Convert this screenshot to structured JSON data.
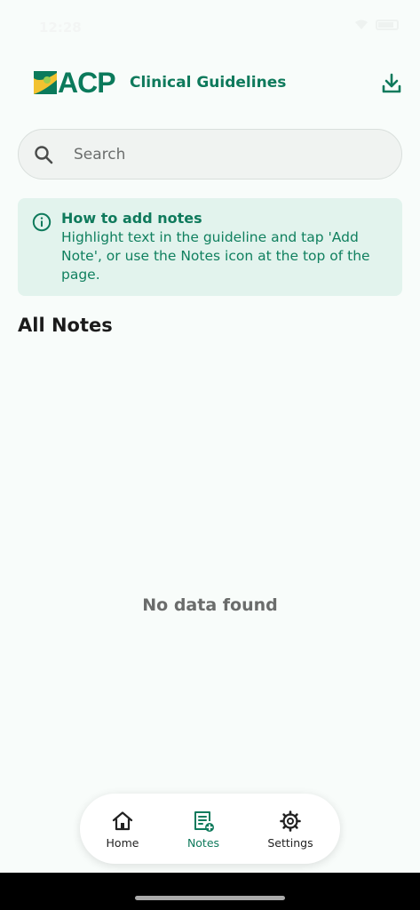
{
  "status_bar": {
    "time": "12:28"
  },
  "header": {
    "logo_text": "ACP",
    "title": "Clinical Guidelines",
    "download_icon": "download-icon"
  },
  "search": {
    "placeholder": "Search",
    "icon": "search-icon"
  },
  "info_card": {
    "icon": "info-icon",
    "title": "How to add notes",
    "body": "Highlight text in the guideline and tap 'Add Note', or use the Notes icon at the top of the page."
  },
  "notes": {
    "section_title": "All Notes",
    "empty_message": "No data found"
  },
  "bottom_nav": {
    "items": [
      {
        "label": "Home",
        "icon": "home-icon",
        "active": false
      },
      {
        "label": "Notes",
        "icon": "notes-icon",
        "active": true
      },
      {
        "label": "Settings",
        "icon": "gear-icon",
        "active": false
      }
    ]
  },
  "colors": {
    "brand_green": "#0f7a5c",
    "info_background": "#e2f3ed",
    "page_background": "#f8fcfa"
  }
}
